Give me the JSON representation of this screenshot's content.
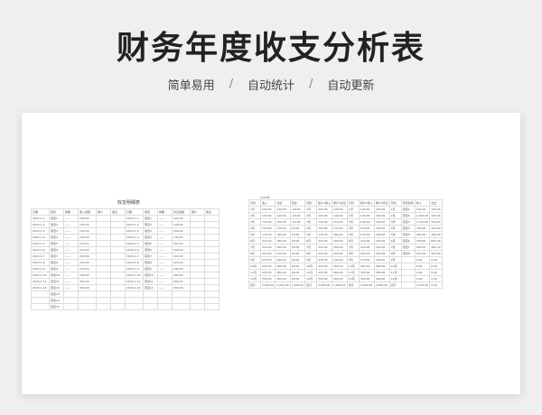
{
  "banner": {
    "title": "财务年度收支分析表",
    "features": [
      "简单易用",
      "自动统计",
      "自动更新"
    ],
    "separator": "/"
  },
  "sheet": {
    "left": {
      "title": "收支明细表",
      "header": [
        "日期",
        "项目",
        "摘要",
        "收入金额",
        "账户",
        "备注",
        "日期",
        "项目",
        "摘要",
        "支出金额",
        "账户",
        "备注"
      ],
      "rows": [
        [
          "2023-1-1",
          "项目1",
          "——",
          "100.00",
          "",
          "",
          "2023-1-1",
          "项目1",
          "——",
          "120.00",
          "",
          ""
        ],
        [
          "2023-1-2",
          "项目2",
          "——",
          "120.00",
          "",
          "",
          "2023-1-2",
          "项目2",
          "——",
          "140.00",
          "",
          ""
        ],
        [
          "2023-1-3",
          "项目3",
          "——",
          "130.00",
          "",
          "",
          "2023-1-3",
          "项目3",
          "——",
          "150.00",
          "",
          ""
        ],
        [
          "2023-1-4",
          "项目4",
          "——",
          "150.00",
          "",
          "",
          "2023-1-4",
          "项目4",
          "——",
          "130.00",
          "",
          ""
        ],
        [
          "2023-1-5",
          "项目5",
          "——",
          "170.00",
          "",
          "",
          "2023-1-5",
          "项目5",
          "——",
          "160.00",
          "",
          ""
        ],
        [
          "2023-1-6",
          "项目6",
          "——",
          "210.00",
          "",
          "",
          "2023-1-6",
          "项目6",
          "——",
          "180.00",
          "",
          ""
        ],
        [
          "2023-1-7",
          "项目7",
          "——",
          "230.00",
          "",
          "",
          "2023-1-7",
          "项目7",
          "——",
          "200.00",
          "",
          ""
        ],
        [
          "2023-1-8",
          "项目8",
          "——",
          "250.00",
          "",
          "",
          "2023-1-8",
          "项目8",
          "——",
          "220.00",
          "",
          ""
        ],
        [
          "2023-1-9",
          "项目9",
          "——",
          "270.00",
          "",
          "",
          "2023-1-9",
          "项目9",
          "——",
          "240.00",
          "",
          ""
        ],
        [
          "2023-1-10",
          "项目10",
          "——",
          "300.00",
          "",
          "",
          "2023-1-10",
          "项目10",
          "——",
          "260.00",
          "",
          ""
        ],
        [
          "2023-1-11",
          "项目11",
          "——",
          "320.00",
          "",
          "",
          "2023-1-11",
          "项目11",
          "——",
          "280.00",
          "",
          ""
        ],
        [
          "2023-1-12",
          "项目12",
          "——",
          "350.00",
          "",
          "",
          "2023-1-12",
          "项目12",
          "——",
          "300.00",
          "",
          ""
        ],
        [
          "",
          "项目13",
          "",
          "",
          "",
          "",
          "",
          "",
          "",
          "",
          "",
          ""
        ],
        [
          "",
          "项目14",
          "",
          "",
          "",
          "",
          "",
          "",
          "",
          "",
          "",
          ""
        ],
        [
          "",
          "项目15",
          "",
          "",
          "",
          "",
          "",
          "",
          "",
          "",
          "",
          ""
        ]
      ]
    },
    "right": {
      "year": "2023年",
      "header": [
        "月份",
        "收入",
        "支出",
        "结余",
        "月份",
        "账户1收入",
        "账户1支出",
        "月份",
        "账户2收入",
        "账户2支出",
        "月份",
        "项目名称",
        "收入",
        "支出"
      ],
      "rows": [
        [
          "1月",
          "100.00",
          "120.00",
          "-20.00",
          "1月",
          "100.00",
          "120.00",
          "1月",
          "100.00",
          "120.00",
          "1月",
          "项目1",
          "100.00",
          "120.00"
        ],
        [
          "2月",
          "120.00",
          "140.00",
          "-20.00",
          "2月",
          "120.00",
          "140.00",
          "2月",
          "120.00",
          "140.00",
          "2月",
          "项目2",
          "1,100.00",
          "120.00"
        ],
        [
          "3月",
          "130.00",
          "150.00",
          "-20.00",
          "3月",
          "130.00",
          "150.00",
          "3月",
          "130.00",
          "150.00",
          "3月",
          "项目3",
          "1,130.00",
          "120.00"
        ],
        [
          "4月",
          "150.00",
          "130.00",
          "20.00",
          "4月",
          "150.00",
          "130.00",
          "4月",
          "150.00",
          "130.00",
          "4月",
          "项目4",
          "750.00",
          "160.00"
        ],
        [
          "5月",
          "170.00",
          "160.00",
          "10.00",
          "5月",
          "170.00",
          "160.00",
          "5月",
          "170.00",
          "160.00",
          "5月",
          "项目5",
          "460.00",
          "180.00"
        ],
        [
          "6月",
          "210.00",
          "180.00",
          "30.00",
          "6月",
          "210.00",
          "180.00",
          "6月",
          "210.00",
          "180.00",
          "6月",
          "项目6",
          "700.00",
          "600.00"
        ],
        [
          "7月",
          "230.00",
          "200.00",
          "30.00",
          "7月",
          "230.00",
          "200.00",
          "7月",
          "230.00",
          "200.00",
          "7月",
          "项目7",
          "450.00",
          "380.00"
        ],
        [
          "8月",
          "250.00",
          "220.00",
          "30.00",
          "8月",
          "250.00",
          "220.00",
          "8月",
          "250.00",
          "220.00",
          "8月",
          "项目8",
          "420.00",
          "300.00"
        ],
        [
          "9月",
          "270.00",
          "240.00",
          "30.00",
          "9月",
          "270.00",
          "240.00",
          "9月",
          "270.00",
          "240.00",
          "9月",
          "",
          "0.00",
          "0.00"
        ],
        [
          "10月",
          "300.00",
          "260.00",
          "40.00",
          "10月",
          "300.00",
          "260.00",
          "10月",
          "300.00",
          "260.00",
          "10月",
          "",
          "0.00",
          "0.00"
        ],
        [
          "11月",
          "320.00",
          "280.00",
          "40.00",
          "11月",
          "320.00",
          "280.00",
          "11月",
          "320.00",
          "280.00",
          "11月",
          "",
          "0.00",
          "0.00"
        ],
        [
          "12月",
          "350.00",
          "300.00",
          "50.00",
          "12月",
          "350.00",
          "300.00",
          "12月",
          "350.00",
          "300.00",
          "12月",
          "",
          "0.00",
          "0.00"
        ],
        [
          "合计",
          "2,600.00",
          "2,600.00",
          "2,900.00",
          "合计",
          "2,600.00",
          "2,600.00",
          "合计",
          "2,600.00",
          "2,600.00",
          "合计",
          "",
          "4,720.00",
          "0.00"
        ]
      ]
    }
  }
}
